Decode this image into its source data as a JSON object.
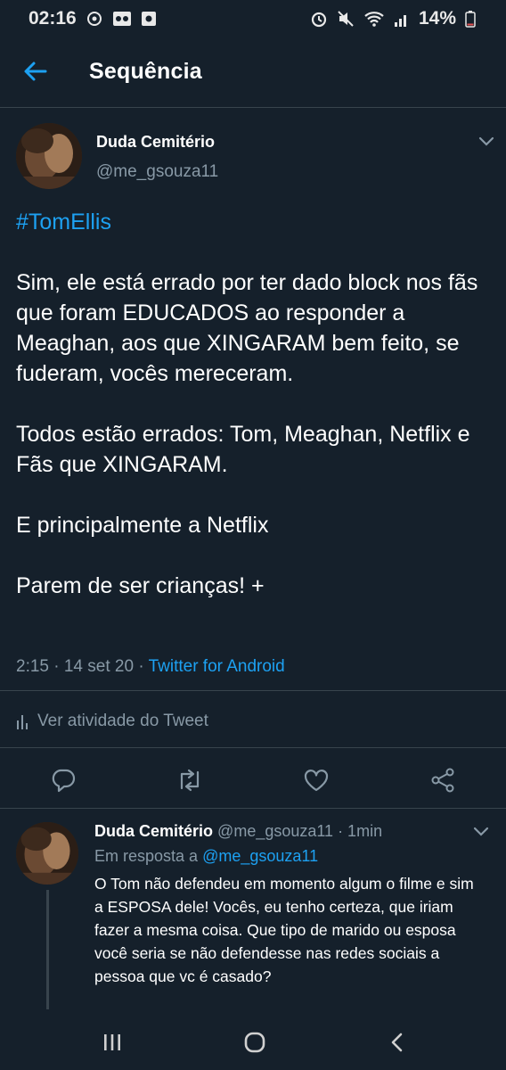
{
  "status_bar": {
    "time": "02:16",
    "battery": "14%"
  },
  "header": {
    "title": "Sequência"
  },
  "tweet": {
    "author_name": "Duda Cemitério",
    "handle": "@me_gsouza11",
    "hashtag": "#TomEllis",
    "text": "Sim, ele está errado por ter dado block nos fãs que foram EDUCADOS ao responder a Meaghan, aos que XINGARAM bem feito, se fuderam, vocês mereceram.\n\nTodos estão errados: Tom, Meaghan, Netflix e Fãs que XINGARAM.\n\nE principalmente a Netflix\n\nParem de ser crianças! +",
    "timestamp": "2:15 · 14 set 20 · ",
    "source": "Twitter for Android",
    "activity_label": "Ver atividade do Tweet"
  },
  "reply": {
    "author_name": "Duda Cemitério",
    "handle_time": "@me_gsouza11 · 1min",
    "replying_to_label": "Em resposta a",
    "replying_to_handle": "@me_gsouza11",
    "text": "O Tom não defendeu em momento algum o filme e sim a ESPOSA dele! Vocês, eu tenho certeza, que iriam fazer a mesma coisa. Que tipo de marido ou esposa você seria se não defendesse nas redes sociais a pessoa que vc é casado?"
  },
  "colors": {
    "background": "#15202b",
    "accent": "#1da1f2",
    "muted": "#8899a6",
    "divider": "#38444d"
  },
  "icons": [
    "alarm-icon",
    "mute-icon",
    "wifi-icon",
    "signal-icon",
    "battery-icon",
    "back-arrow-icon",
    "chevron-down-icon",
    "bar-chart-icon",
    "reply-icon",
    "retweet-icon",
    "like-icon",
    "share-icon"
  ]
}
